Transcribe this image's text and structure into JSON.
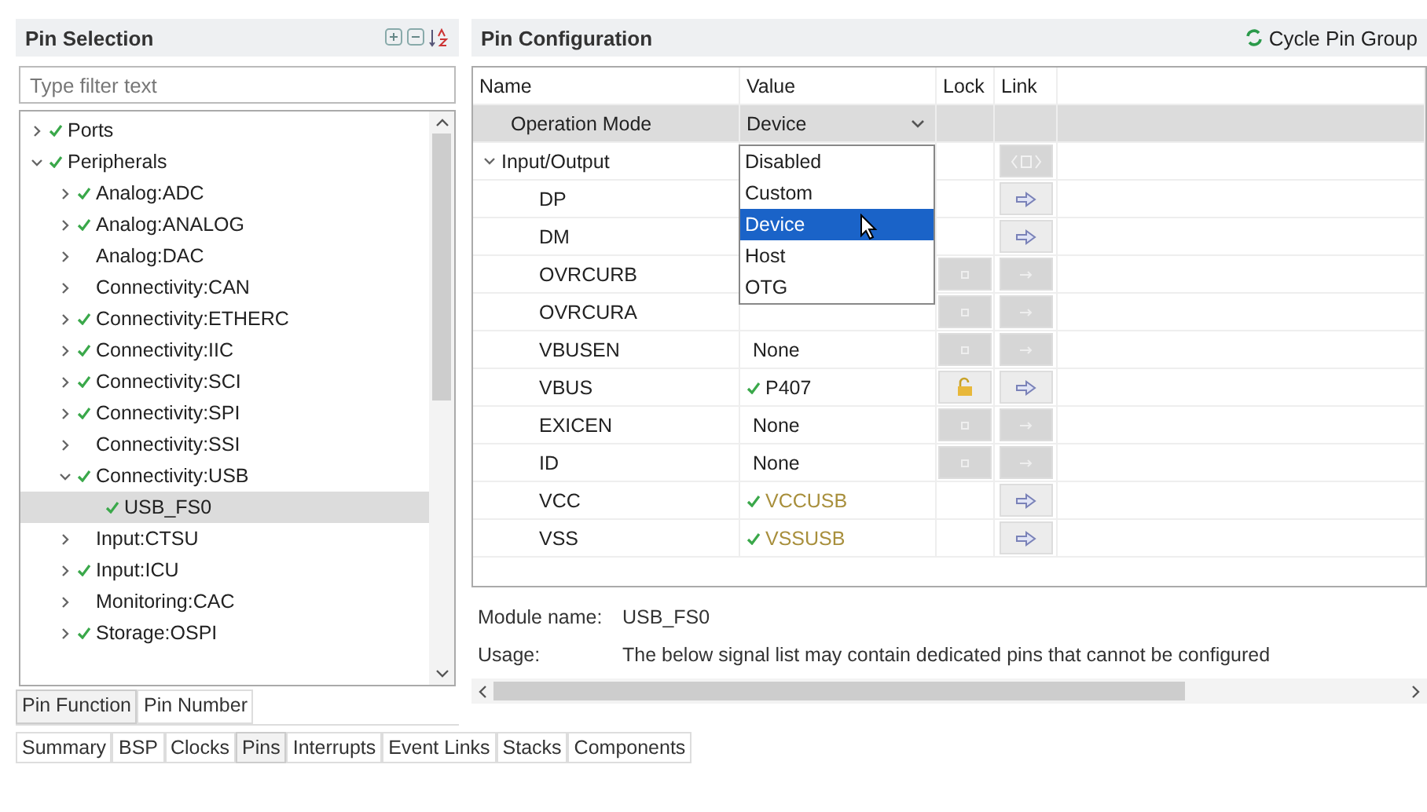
{
  "pin_selection": {
    "title": "Pin Selection",
    "filter": {
      "placeholder": "Type filter text"
    },
    "tree": [
      {
        "label": "Ports",
        "checked": true,
        "expanded": false,
        "selected": false
      },
      {
        "label": "Peripherals",
        "checked": true,
        "expanded": true,
        "selected": false,
        "children": [
          {
            "label": "Analog:ADC",
            "checked": true,
            "expanded": false,
            "selected": false
          },
          {
            "label": "Analog:ANALOG",
            "checked": true,
            "expanded": false,
            "selected": false
          },
          {
            "label": "Analog:DAC",
            "checked": false,
            "expanded": false,
            "selected": false
          },
          {
            "label": "Connectivity:CAN",
            "checked": false,
            "expanded": false,
            "selected": false
          },
          {
            "label": "Connectivity:ETHERC",
            "checked": true,
            "expanded": false,
            "selected": false
          },
          {
            "label": "Connectivity:IIC",
            "checked": true,
            "expanded": false,
            "selected": false
          },
          {
            "label": "Connectivity:SCI",
            "checked": true,
            "expanded": false,
            "selected": false
          },
          {
            "label": "Connectivity:SPI",
            "checked": true,
            "expanded": false,
            "selected": false
          },
          {
            "label": "Connectivity:SSI",
            "checked": false,
            "expanded": false,
            "selected": false
          },
          {
            "label": "Connectivity:USB",
            "checked": true,
            "expanded": true,
            "selected": false,
            "children": [
              {
                "label": "USB_FS0",
                "checked": true,
                "selected": true
              }
            ]
          },
          {
            "label": "Input:CTSU",
            "checked": false,
            "expanded": false,
            "selected": false
          },
          {
            "label": "Input:ICU",
            "checked": true,
            "expanded": false,
            "selected": false
          },
          {
            "label": "Monitoring:CAC",
            "checked": false,
            "expanded": false,
            "selected": false
          },
          {
            "label": "Storage:OSPI",
            "checked": true,
            "expanded": false,
            "selected": false
          }
        ]
      }
    ],
    "tabs": [
      {
        "label": "Pin Function",
        "selected": true
      },
      {
        "label": "Pin Number",
        "selected": false
      }
    ]
  },
  "pin_configuration": {
    "title": "Pin Configuration",
    "action": "Cycle Pin Group",
    "table": {
      "columns": [
        "Name",
        "Value",
        "Lock",
        "Link"
      ],
      "rows": [
        {
          "name": "Operation Mode",
          "value": {
            "text": "Device",
            "kind": "combo"
          },
          "selected": true
        },
        {
          "name": "Input/Output",
          "expanded": true,
          "link": {
            "kind": "split"
          },
          "selected": false,
          "children": [
            {
              "name": "DP",
              "link": {
                "kind": "arrow"
              },
              "selected": false
            },
            {
              "name": "DM",
              "link": {
                "kind": "arrow"
              },
              "selected": false
            },
            {
              "name": "OVRCURB",
              "lock": {
                "kind": "disabled"
              },
              "link": {
                "kind": "disabled"
              },
              "selected": false
            },
            {
              "name": "OVRCURA",
              "lock": {
                "kind": "disabled"
              },
              "link": {
                "kind": "disabled"
              },
              "selected": false
            },
            {
              "name": "VBUSEN",
              "value": {
                "text": "None",
                "kind": "plain",
                "checked": false
              },
              "lock": {
                "kind": "disabled"
              },
              "link": {
                "kind": "disabled"
              },
              "selected": false
            },
            {
              "name": "VBUS",
              "value": {
                "text": "P407",
                "kind": "plain",
                "checked": true
              },
              "lock": {
                "kind": "unlocked"
              },
              "link": {
                "kind": "arrow"
              },
              "selected": false
            },
            {
              "name": "EXICEN",
              "value": {
                "text": "None",
                "kind": "plain",
                "checked": false
              },
              "lock": {
                "kind": "disabled"
              },
              "link": {
                "kind": "disabled"
              },
              "selected": false
            },
            {
              "name": "ID",
              "value": {
                "text": "None",
                "kind": "plain",
                "checked": false
              },
              "lock": {
                "kind": "disabled"
              },
              "link": {
                "kind": "disabled"
              },
              "selected": false
            },
            {
              "name": "VCC",
              "value": {
                "text": "VCCUSB",
                "kind": "power",
                "checked": true
              },
              "link": {
                "kind": "arrow"
              },
              "selected": false
            },
            {
              "name": "VSS",
              "value": {
                "text": "VSSUSB",
                "kind": "power",
                "checked": true
              },
              "link": {
                "kind": "arrow"
              },
              "selected": false
            }
          ]
        }
      ]
    },
    "dropdown": {
      "options": [
        {
          "label": "Disabled",
          "selected": false
        },
        {
          "label": "Custom",
          "selected": false
        },
        {
          "label": "Device",
          "selected": true
        },
        {
          "label": "Host",
          "selected": false
        },
        {
          "label": "OTG",
          "selected": false
        }
      ]
    },
    "details": [
      {
        "label": "Module name:",
        "value": "USB_FS0"
      },
      {
        "label": "Usage:",
        "value": "The below signal list may contain dedicated pins that cannot be configured"
      }
    ]
  },
  "editor_tabs": [
    {
      "label": "Summary",
      "selected": false
    },
    {
      "label": "BSP",
      "selected": false
    },
    {
      "label": "Clocks",
      "selected": false
    },
    {
      "label": "Pins",
      "selected": true
    },
    {
      "label": "Interrupts",
      "selected": false
    },
    {
      "label": "Event Links",
      "selected": false
    },
    {
      "label": "Stacks",
      "selected": false
    },
    {
      "label": "Components",
      "selected": false
    }
  ]
}
